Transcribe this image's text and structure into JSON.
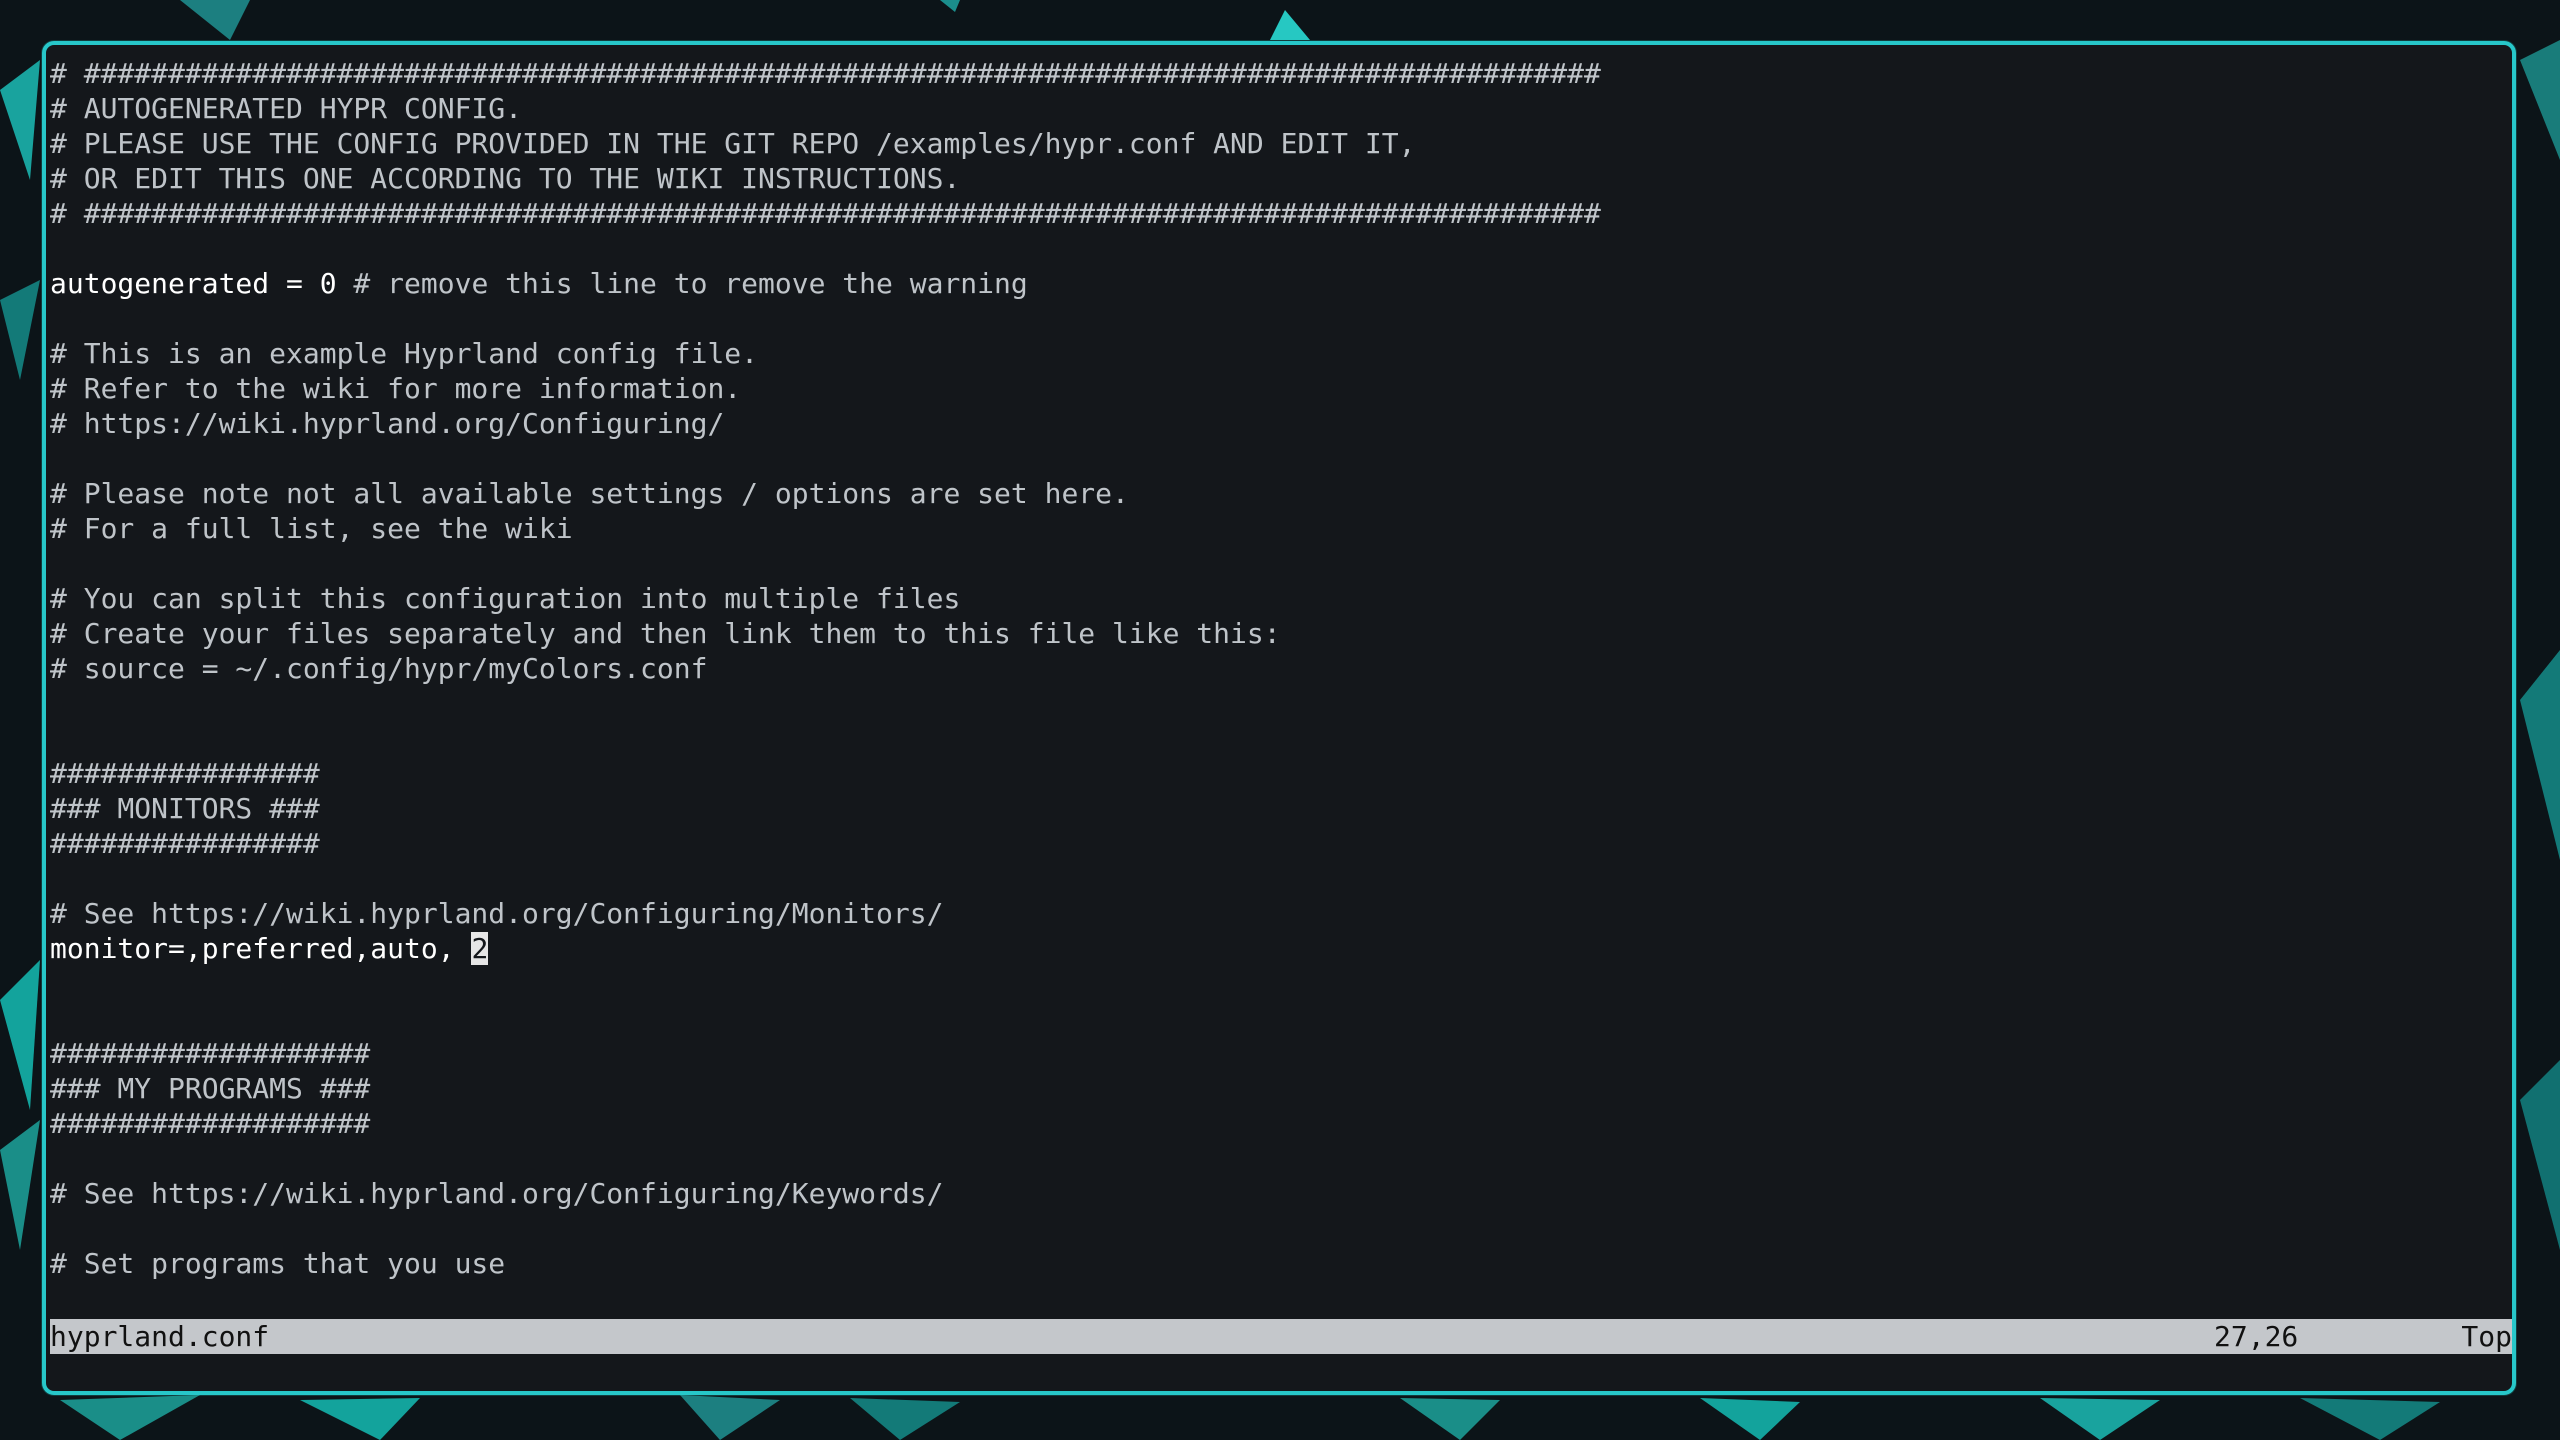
{
  "editor": {
    "lines": [
      {
        "text": "# ##########################################################################################",
        "bright": false
      },
      {
        "text": "# AUTOGENERATED HYPR CONFIG.",
        "bright": false
      },
      {
        "text": "# PLEASE USE THE CONFIG PROVIDED IN THE GIT REPO /examples/hypr.conf AND EDIT IT,",
        "bright": false
      },
      {
        "text": "# OR EDIT THIS ONE ACCORDING TO THE WIKI INSTRUCTIONS.",
        "bright": false
      },
      {
        "text": "# ##########################################################################################",
        "bright": false
      },
      {
        "text": "",
        "bright": false
      },
      {
        "text": "autogenerated = 0",
        "bright": true,
        "suffix": " # remove this line to remove the warning"
      },
      {
        "text": "",
        "bright": false
      },
      {
        "text": "# This is an example Hyprland config file.",
        "bright": false
      },
      {
        "text": "# Refer to the wiki for more information.",
        "bright": false
      },
      {
        "text": "# https://wiki.hyprland.org/Configuring/",
        "bright": false
      },
      {
        "text": "",
        "bright": false
      },
      {
        "text": "# Please note not all available settings / options are set here.",
        "bright": false
      },
      {
        "text": "# For a full list, see the wiki",
        "bright": false
      },
      {
        "text": "",
        "bright": false
      },
      {
        "text": "# You can split this configuration into multiple files",
        "bright": false
      },
      {
        "text": "# Create your files separately and then link them to this file like this:",
        "bright": false
      },
      {
        "text": "# source = ~/.config/hypr/myColors.conf",
        "bright": false
      },
      {
        "text": "",
        "bright": false
      },
      {
        "text": "",
        "bright": false
      },
      {
        "text": "################",
        "bright": false
      },
      {
        "text": "### MONITORS ###",
        "bright": false
      },
      {
        "text": "################",
        "bright": false
      },
      {
        "text": "",
        "bright": false
      },
      {
        "text": "# See https://wiki.hyprland.org/Configuring/Monitors/",
        "bright": false
      },
      {
        "text": "monitor=,preferred,auto, ",
        "bright": true,
        "cursor": "2"
      },
      {
        "text": "",
        "bright": false
      },
      {
        "text": "",
        "bright": false
      },
      {
        "text": "###################",
        "bright": false
      },
      {
        "text": "### MY PROGRAMS ###",
        "bright": false
      },
      {
        "text": "###################",
        "bright": false
      },
      {
        "text": "",
        "bright": false
      },
      {
        "text": "# See https://wiki.hyprland.org/Configuring/Keywords/",
        "bright": false
      },
      {
        "text": "",
        "bright": false
      },
      {
        "text": "# Set programs that you use",
        "bright": false
      }
    ]
  },
  "statusbar": {
    "filename": "hyprland.conf",
    "position": "27,26",
    "scroll": "Top"
  },
  "colors": {
    "accent_border": "#27c7c9",
    "editor_bg": "#14171b",
    "text": "#bfc4c9",
    "statusbar_bg": "#c4c7cb"
  }
}
